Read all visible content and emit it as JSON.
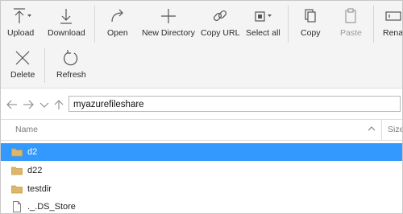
{
  "toolbar": {
    "upload": "Upload",
    "download": "Download",
    "open": "Open",
    "new_directory": "New Directory",
    "copy_url": "Copy URL",
    "select_all": "Select all",
    "copy": "Copy",
    "paste": "Paste",
    "rename": "Rena",
    "delete": "Delete",
    "refresh": "Refresh"
  },
  "address": {
    "path": "myazurefileshare"
  },
  "list": {
    "columns": {
      "name": "Name",
      "size": "Size"
    },
    "items": [
      {
        "name": "d2",
        "type": "folder",
        "selected": true
      },
      {
        "name": "d22",
        "type": "folder",
        "selected": false
      },
      {
        "name": "testdir",
        "type": "folder",
        "selected": false
      },
      {
        "name": "._.DS_Store",
        "type": "file",
        "selected": false
      }
    ]
  },
  "colors": {
    "selection": "#3399ff",
    "folder": "#dcb66a",
    "toolbar_bg": "#f4f4f4"
  }
}
